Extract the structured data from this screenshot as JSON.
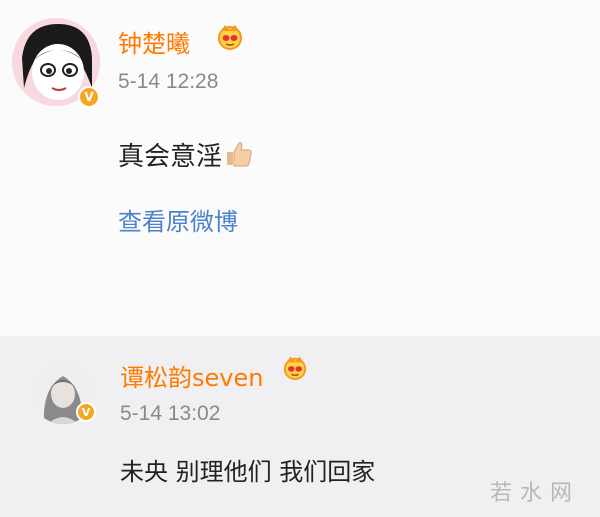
{
  "comments": [
    {
      "author": "钟楚曦",
      "time": "5-14 12:28",
      "text": "真会意淫",
      "emoji_icon": "thumbs-up-icon",
      "link_label": "查看原微博",
      "verified_badge": "V",
      "vip_icon": "crown-vip-icon"
    },
    {
      "author": "谭松韵seven",
      "time": "5-14 13:02",
      "text": "未央 别理他们 我们回家",
      "verified_badge": "V",
      "vip_icon": "crown-vip-icon"
    }
  ],
  "watermark": "若水网",
  "colors": {
    "author": "#ff7a00",
    "link": "#4a83c9",
    "time": "#8a8a8a",
    "badge": "#f6a623"
  }
}
